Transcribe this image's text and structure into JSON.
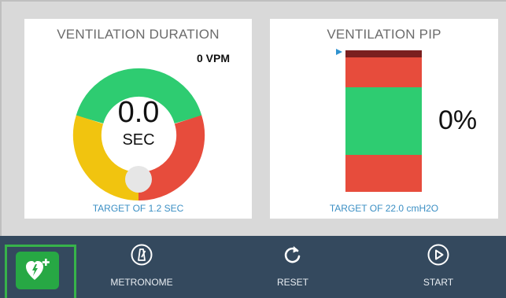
{
  "panels": {
    "duration": {
      "title": "VENTILATION DURATION",
      "rate": "0 VPM",
      "value": "0.0",
      "unit": "SEC",
      "target": "TARGET OF 1.2 SEC",
      "gauge_colors": {
        "green": "#2ecc71",
        "red": "#e74c3c",
        "yellow": "#f1c40f",
        "knob": "#e6e6e6"
      }
    },
    "pip": {
      "title": "VENTILATION PIP",
      "percent": "0%",
      "target": "TARGET OF 22.0 cmH2O",
      "bar_colors": {
        "top": "#7a1f1f",
        "high": "#e74c3c",
        "target_zone": "#2ecc71",
        "low": "#e74c3c",
        "marker": "#2f92cf"
      }
    }
  },
  "toolbar": {
    "aed_icon": "aed-heart-plus-icon",
    "metronome_label": "METRONOME",
    "metronome_icon": "metronome-icon",
    "reset_label": "RESET",
    "reset_icon": "reset-arrow-icon",
    "start_label": "START",
    "start_icon": "play-circle-icon",
    "colors": {
      "bar": "#34495e",
      "aed": "#27a844",
      "aed_frame": "#37b34a"
    }
  }
}
